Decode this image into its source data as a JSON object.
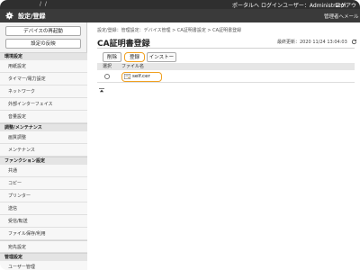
{
  "topbar": {
    "slash": "/ /",
    "portal": "ポータルへ",
    "login_user": "ログインユーザー：Administrator",
    "logout": "ログアウト"
  },
  "header": {
    "title": "設定/登録",
    "mail": "管理者へメール"
  },
  "sidebar": {
    "restart_button": "デバイスの再起動",
    "apply_button": "設定の反映",
    "sections": [
      {
        "heading": "環境設定",
        "items": [
          "用紙設定",
          "タイマー/電力設定",
          "ネットワーク",
          "外部インターフェイス",
          "音量設定"
        ]
      },
      {
        "heading": "調整/メンテナンス",
        "items": [
          "画質調整",
          "メンテナンス"
        ]
      },
      {
        "heading": "ファンクション設定",
        "items": [
          "共通",
          "コピー",
          "プリンター",
          "送信",
          "受信/転送",
          "ファイル保存/利用"
        ]
      },
      {
        "heading": "",
        "items": [
          "宛先設定"
        ]
      },
      {
        "heading": "管理設定",
        "items": [
          "ユーザー管理"
        ]
      }
    ]
  },
  "main": {
    "breadcrumb": "設定/登録：管理設定：デバイス管理 > CA証明書設定 > CA証明書登録",
    "title": "CA証明書登録",
    "updated": "最終更新：2020 11/24 13:04:03",
    "toolbar": {
      "delete": "削除",
      "register": "登録",
      "install": "インストール..."
    },
    "table": {
      "headers": [
        "選択",
        "ファイル名"
      ],
      "rows": [
        {
          "filename": "self.cer",
          "selected": false
        }
      ]
    }
  },
  "icons": {
    "header": "gear-icon",
    "refresh": "refresh-icon",
    "certificate": "certificate-icon",
    "collapse": "collapse-icon"
  },
  "colors": {
    "highlight": "#f0a020",
    "header_bg": "#3a3a3a",
    "topbar_bg": "#2f2f2f"
  }
}
